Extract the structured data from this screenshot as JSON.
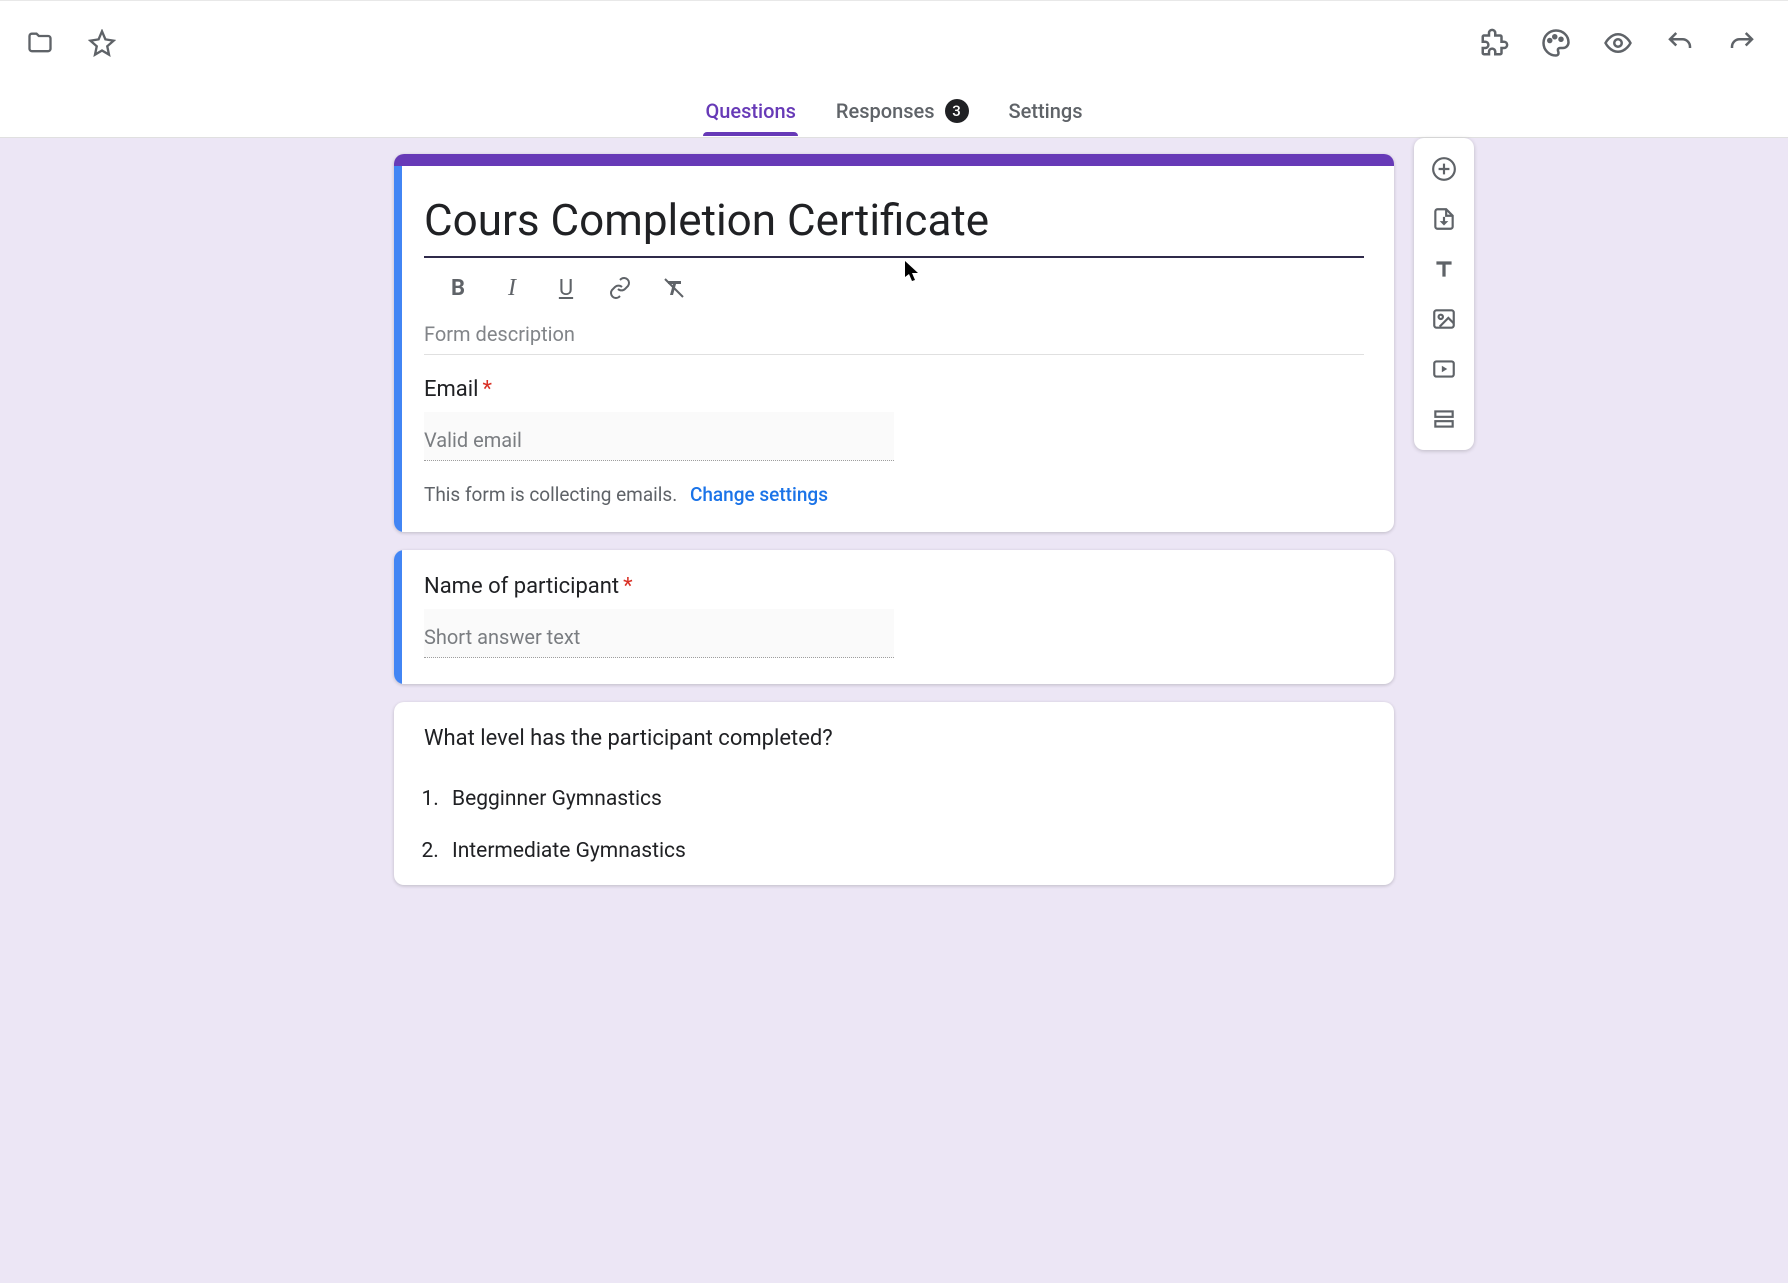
{
  "toolbar": {
    "folder_icon": "folder",
    "star_icon": "star",
    "addons_icon": "addons",
    "palette_icon": "palette",
    "preview_icon": "preview",
    "undo_icon": "undo",
    "redo_icon": "redo"
  },
  "tabs": {
    "questions": "Questions",
    "responses": "Responses",
    "responses_count": "3",
    "settings": "Settings"
  },
  "form": {
    "title": "Cours Completion Certificate",
    "description_placeholder": "Form description",
    "email_label": "Email",
    "email_placeholder": "Valid email",
    "collecting_note": "This form is collecting emails.",
    "change_settings": "Change settings"
  },
  "formatting": {
    "bold": "B",
    "italic": "I",
    "underline": "U"
  },
  "q_name": {
    "label": "Name of participant",
    "placeholder": "Short answer text"
  },
  "q_level": {
    "label": "What level has the participant completed?",
    "opt1": "Begginner Gymnastics",
    "opt2": "Intermediate Gymnastics"
  },
  "side": {
    "add": "add-question",
    "import": "import-questions",
    "title": "add-title",
    "image": "add-image",
    "video": "add-video",
    "section": "add-section"
  },
  "colors": {
    "theme": "#673ab7",
    "accent": "#4285f4",
    "canvas": "#ece6f5"
  }
}
